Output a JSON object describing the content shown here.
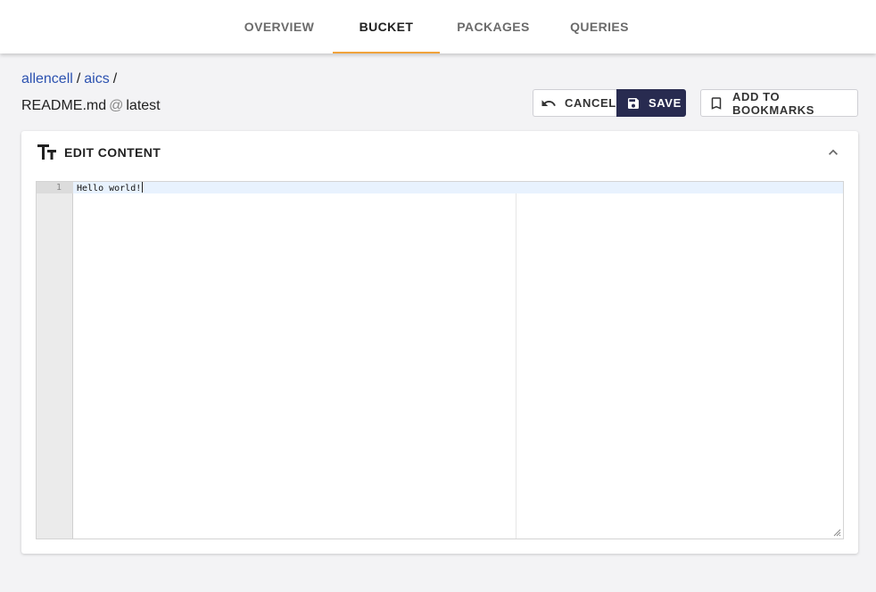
{
  "nav": {
    "tabs": [
      {
        "label": "Overview"
      },
      {
        "label": "Bucket",
        "active": true
      },
      {
        "label": "Packages"
      },
      {
        "label": "Queries"
      }
    ],
    "accent_color": "#f0a23b"
  },
  "breadcrumb": {
    "items": [
      "allencell",
      "aics"
    ],
    "separator": "/"
  },
  "file": {
    "name": "README.md",
    "at": "@",
    "version": "latest"
  },
  "toolbar": {
    "cancel_label": "Cancel",
    "save_label": "Save",
    "bookmark_label": "Add to bookmarks",
    "save_color": "#282b50"
  },
  "panel": {
    "title": "Edit content"
  },
  "editor": {
    "lines": [
      {
        "number": "1",
        "text": "Hello world!"
      }
    ]
  }
}
